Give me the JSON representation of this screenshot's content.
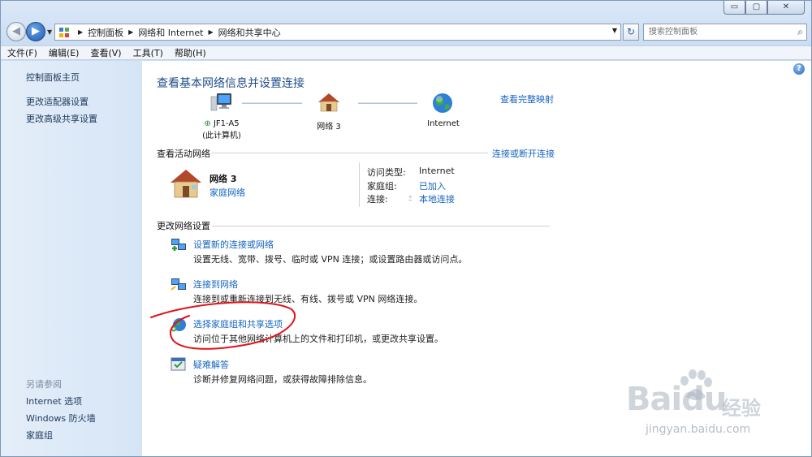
{
  "window": {
    "controls": [
      "▭",
      "▢",
      "✕"
    ]
  },
  "address_bar": {
    "breadcrumbs": [
      "控制面板",
      "网络和 Internet",
      "网络和共享中心"
    ]
  },
  "search": {
    "placeholder": "搜索控制面板"
  },
  "menu": [
    "文件(F)",
    "编辑(E)",
    "查看(V)",
    "工具(T)",
    "帮助(H)"
  ],
  "sidebar": {
    "links": [
      "控制面板主页",
      "更改适配器设置",
      "更改高级共享设置"
    ],
    "see_also_heading": "另请参阅",
    "see_also": [
      "Internet 选项",
      "Windows 防火墙",
      "家庭组"
    ]
  },
  "main": {
    "title": "查看基本网络信息并设置连接",
    "view_full_map": "查看完整映射",
    "map_nodes": [
      {
        "label": "JF1-A5",
        "sublabel": "(此计算机)",
        "icon": "computer-icon"
      },
      {
        "label": "网络  3",
        "icon": "house-icon"
      },
      {
        "label": "Internet",
        "icon": "globe-icon"
      }
    ],
    "active_networks_label": "查看活动网络",
    "connect_disconnect": "连接或断开连接",
    "active_network": {
      "name": "网络  3",
      "type": "家庭网络",
      "access_type_label": "访问类型:",
      "access_type_value": "Internet",
      "homegroup_label": "家庭组:",
      "homegroup_value": "已加入",
      "connection_label": "连接:",
      "connection_value": "本地连接"
    },
    "change_settings_label": "更改网络设置",
    "tasks": [
      {
        "title": "设置新的连接或网络",
        "desc": "设置无线、宽带、拨号、临时或 VPN 连接；或设置路由器或访问点。",
        "icon": "new-connection-icon"
      },
      {
        "title": "连接到网络",
        "desc": "连接到或重新连接到无线、有线、拨号或 VPN 网络连接。",
        "icon": "connect-network-icon"
      },
      {
        "title": "选择家庭组和共享选项",
        "desc": "访问位于其他网络计算机上的文件和打印机，或更改共享设置。",
        "icon": "homegroup-icon"
      },
      {
        "title": "疑难解答",
        "desc": "诊断并修复网络问题，或获得故障排除信息。",
        "icon": "troubleshoot-icon"
      }
    ]
  },
  "watermark": {
    "brand": "Bai",
    "brand2": "du",
    "cn": "经验",
    "url": "jingyan.baidu.com"
  },
  "colors": {
    "link": "#1565c0",
    "title": "#1d4d8a",
    "annotation": "#e0121b"
  }
}
